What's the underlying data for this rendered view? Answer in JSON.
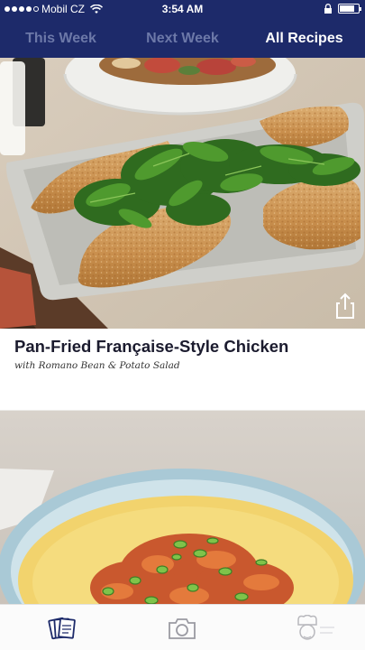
{
  "status_bar": {
    "carrier": "Mobil CZ",
    "time": "3:54 AM",
    "signal_icon": "signal-dots-icon",
    "wifi_icon": "wifi-icon",
    "lock_icon": "rotation-lock-icon",
    "battery_icon": "battery-icon"
  },
  "tabs": [
    {
      "label": "This Week",
      "active": false
    },
    {
      "label": "Next Week",
      "active": false
    },
    {
      "label": "All Recipes",
      "active": true
    }
  ],
  "recipes": [
    {
      "title": "Pan-Fried Française-Style Chicken",
      "subtitle": "with Romano Bean & Potato Salad",
      "share_icon": "share-icon"
    },
    {
      "image": "polenta-dish-photo"
    }
  ],
  "bottom_bar": {
    "items": [
      {
        "icon": "recipe-cards-icon"
      },
      {
        "icon": "camera-icon"
      },
      {
        "icon": "chef-profile-icon"
      }
    ]
  },
  "colors": {
    "nav_bg": "#1d2a6a",
    "tab_inactive": "#6c78a8",
    "tab_active": "#ffffff",
    "title": "#1b1b2e"
  }
}
